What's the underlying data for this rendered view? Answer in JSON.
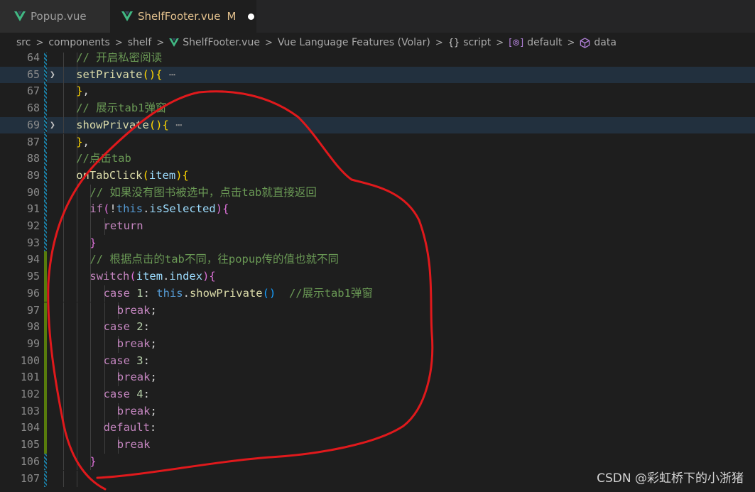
{
  "tabs": [
    {
      "label": "Popup.vue",
      "active": false,
      "icon": "vue-icon"
    },
    {
      "label": "ShelfFooter.vue",
      "active": true,
      "icon": "vue-icon",
      "modified_badge": "M",
      "unsaved": true
    }
  ],
  "breadcrumb": [
    {
      "label": "src",
      "icon": null
    },
    {
      "label": "components",
      "icon": null
    },
    {
      "label": "shelf",
      "icon": null
    },
    {
      "label": "ShelfFooter.vue",
      "icon": "vue-icon"
    },
    {
      "label": "Vue Language Features (Volar)",
      "icon": null
    },
    {
      "label": "script",
      "icon": "braces-icon"
    },
    {
      "label": "default",
      "icon": "method-icon"
    },
    {
      "label": "data",
      "icon": "cube-icon"
    }
  ],
  "icons": {
    "braces": "{}",
    "method": "[⊚]"
  },
  "editor": {
    "lines": [
      {
        "n": "64",
        "indent": 2,
        "gutter": "mod",
        "tokens": [
          [
            "cm",
            "// 开启私密阅读"
          ]
        ]
      },
      {
        "n": "65",
        "indent": 2,
        "gutter": "mod",
        "fold": true,
        "hl": true,
        "tokens": [
          [
            "fn",
            "setPrivate"
          ],
          [
            "br1",
            "()"
          ],
          [
            "br1",
            "{"
          ],
          [
            "dots",
            " ⋯"
          ]
        ]
      },
      {
        "n": "67",
        "indent": 2,
        "gutter": "mod",
        "tokens": [
          [
            "br1",
            "}"
          ],
          [
            "p",
            ","
          ]
        ]
      },
      {
        "n": "68",
        "indent": 2,
        "gutter": "mod",
        "tokens": [
          [
            "cm",
            "// 展示tab1弹窗"
          ]
        ]
      },
      {
        "n": "69",
        "indent": 2,
        "gutter": "mod",
        "fold": true,
        "hl": true,
        "tokens": [
          [
            "fn",
            "showPrivate"
          ],
          [
            "br1",
            "()"
          ],
          [
            "br1",
            "{"
          ],
          [
            "dots",
            " ⋯"
          ]
        ]
      },
      {
        "n": "87",
        "indent": 2,
        "gutter": "mod",
        "tokens": [
          [
            "br1",
            "}"
          ],
          [
            "p",
            ","
          ]
        ]
      },
      {
        "n": "88",
        "indent": 2,
        "gutter": "mod",
        "tokens": [
          [
            "cm",
            "//点击tab"
          ]
        ]
      },
      {
        "n": "89",
        "indent": 2,
        "gutter": "mod",
        "tokens": [
          [
            "fn",
            "onTabClick"
          ],
          [
            "br1",
            "("
          ],
          [
            "var",
            "item"
          ],
          [
            "br1",
            ")"
          ],
          [
            "br1",
            "{"
          ]
        ]
      },
      {
        "n": "90",
        "indent": 3,
        "gutter": "mod",
        "tokens": [
          [
            "cm",
            "// 如果没有图书被选中，点击tab就直接返回"
          ]
        ]
      },
      {
        "n": "91",
        "indent": 3,
        "gutter": "mod",
        "tokens": [
          [
            "kw",
            "if"
          ],
          [
            "br2",
            "("
          ],
          [
            "p",
            "!"
          ],
          [
            "this",
            "this"
          ],
          [
            "p",
            "."
          ],
          [
            "var",
            "isSelected"
          ],
          [
            "br2",
            ")"
          ],
          [
            "br2",
            "{"
          ]
        ]
      },
      {
        "n": "92",
        "indent": 4,
        "gutter": "mod",
        "tokens": [
          [
            "kw",
            "return"
          ]
        ]
      },
      {
        "n": "93",
        "indent": 3,
        "gutter": "mod",
        "tokens": [
          [
            "br2",
            "}"
          ]
        ]
      },
      {
        "n": "94",
        "indent": 3,
        "gutter": "add",
        "tokens": [
          [
            "cm",
            "// 根据点击的tab不同，往popup传的值也就不同"
          ]
        ]
      },
      {
        "n": "95",
        "indent": 3,
        "gutter": "add",
        "tokens": [
          [
            "kw",
            "switch"
          ],
          [
            "br2",
            "("
          ],
          [
            "var",
            "item"
          ],
          [
            "p",
            "."
          ],
          [
            "var",
            "index"
          ],
          [
            "br2",
            ")"
          ],
          [
            "br2",
            "{"
          ]
        ]
      },
      {
        "n": "96",
        "indent": 4,
        "gutter": "add",
        "tokens": [
          [
            "kw",
            "case "
          ],
          [
            "num",
            "1"
          ],
          [
            "p",
            ": "
          ],
          [
            "this",
            "this"
          ],
          [
            "p",
            "."
          ],
          [
            "fn",
            "showPrivate"
          ],
          [
            "br3",
            "()"
          ],
          [
            "p",
            "  "
          ],
          [
            "cm",
            "//展示tab1弹窗"
          ]
        ]
      },
      {
        "n": "97",
        "indent": 5,
        "gutter": "add",
        "tokens": [
          [
            "kw",
            "break"
          ],
          [
            "p",
            ";"
          ]
        ]
      },
      {
        "n": "98",
        "indent": 4,
        "gutter": "add",
        "tokens": [
          [
            "kw",
            "case "
          ],
          [
            "num",
            "2"
          ],
          [
            "p",
            ":"
          ]
        ]
      },
      {
        "n": "99",
        "indent": 5,
        "gutter": "add",
        "tokens": [
          [
            "kw",
            "break"
          ],
          [
            "p",
            ";"
          ]
        ]
      },
      {
        "n": "100",
        "indent": 4,
        "gutter": "add",
        "tokens": [
          [
            "kw",
            "case "
          ],
          [
            "num",
            "3"
          ],
          [
            "p",
            ":"
          ]
        ]
      },
      {
        "n": "101",
        "indent": 5,
        "gutter": "add",
        "tokens": [
          [
            "kw",
            "break"
          ],
          [
            "p",
            ";"
          ]
        ]
      },
      {
        "n": "102",
        "indent": 4,
        "gutter": "add",
        "tokens": [
          [
            "kw",
            "case "
          ],
          [
            "num",
            "4"
          ],
          [
            "p",
            ":"
          ]
        ]
      },
      {
        "n": "103",
        "indent": 5,
        "gutter": "add",
        "tokens": [
          [
            "kw",
            "break"
          ],
          [
            "p",
            ";"
          ]
        ]
      },
      {
        "n": "104",
        "indent": 4,
        "gutter": "add",
        "tokens": [
          [
            "kw",
            "default"
          ],
          [
            "p",
            ":"
          ]
        ]
      },
      {
        "n": "105",
        "indent": 5,
        "gutter": "add",
        "tokens": [
          [
            "kw",
            "break"
          ]
        ]
      },
      {
        "n": "106",
        "indent": 3,
        "gutter": "mod",
        "tokens": [
          [
            "br2",
            "}"
          ]
        ]
      },
      {
        "n": "107",
        "indent": 2,
        "gutter": "mod",
        "tokens": []
      }
    ]
  },
  "watermark": "CSDN @彩虹桥下的小浙猪",
  "colors": {
    "annotation": "#e0191c",
    "accent_modified": "#e2c08d"
  }
}
